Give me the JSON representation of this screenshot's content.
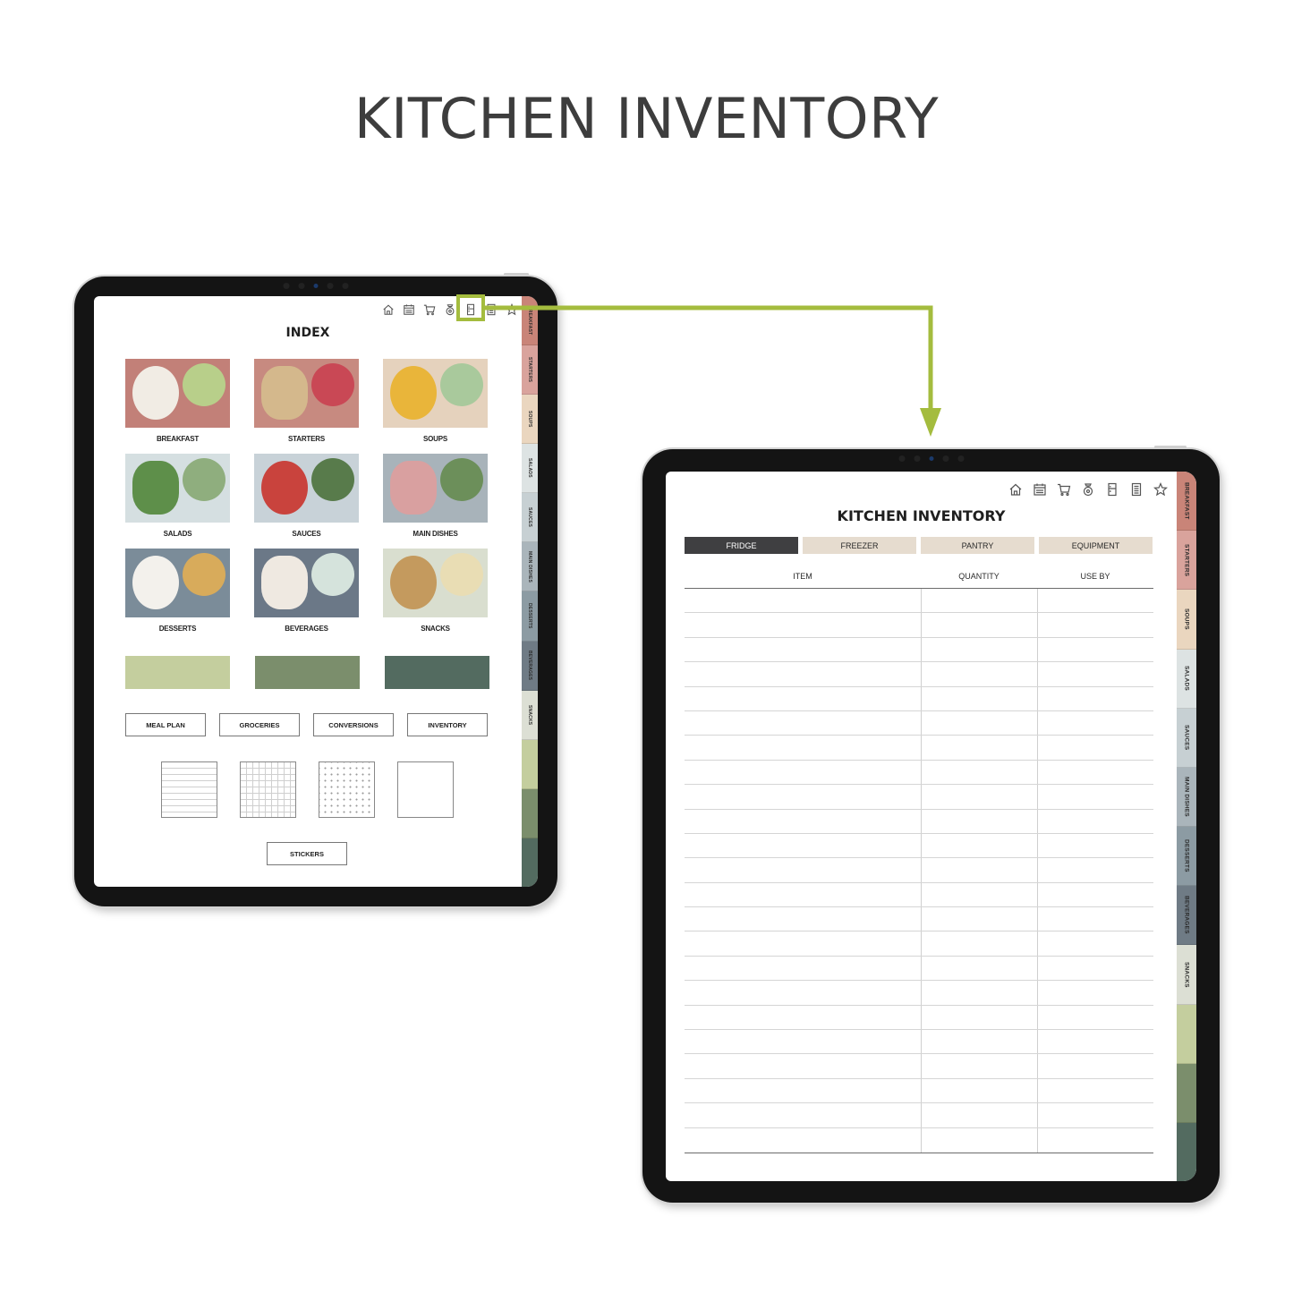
{
  "page": {
    "title": "KITCHEN INVENTORY",
    "accent_color": "#a4bc3e"
  },
  "nav_icons": [
    "home-icon",
    "calendar-icon",
    "cart-icon",
    "scale-icon",
    "fridge-icon",
    "notes-icon",
    "star-icon"
  ],
  "highlighted_nav_icon": "fridge-icon",
  "side_tabs": [
    {
      "label": "BREAKFAST",
      "color": "#c98478"
    },
    {
      "label": "STARTERS",
      "color": "#d9a39c"
    },
    {
      "label": "SOUPS",
      "color": "#ead6bf"
    },
    {
      "label": "SALADS",
      "color": "#dde3e3"
    },
    {
      "label": "SAUCES",
      "color": "#c7d0d3"
    },
    {
      "label": "MAIN DISHES",
      "color": "#aab5bb"
    },
    {
      "label": "DESSERTS",
      "color": "#8c9ba3"
    },
    {
      "label": "BEVERAGES",
      "color": "#6f7b85"
    },
    {
      "label": "SNACKS",
      "color": "#dcdfd4"
    },
    {
      "label": "",
      "color": "#c4ce9e"
    },
    {
      "label": "",
      "color": "#7b8e6c"
    },
    {
      "label": "",
      "color": "#536b60"
    }
  ],
  "index_page": {
    "title": "INDEX",
    "categories": [
      {
        "label": "BREAKFAST",
        "bg": "#c28078",
        "a": "#f1ece4",
        "b": "#b8cf8a"
      },
      {
        "label": "STARTERS",
        "bg": "#c78a80",
        "a": "#d4b88c",
        "b": "#c94855"
      },
      {
        "label": "SOUPS",
        "bg": "#e5d2bd",
        "a": "#e9b53a",
        "b": "#a9c99c"
      },
      {
        "label": "SALADS",
        "bg": "#d5dfe1",
        "a": "#5e8f4a",
        "b": "#8fae7e"
      },
      {
        "label": "SAUCES",
        "bg": "#c8d2d8",
        "a": "#c9433d",
        "b": "#587b4b"
      },
      {
        "label": "MAIN DISHES",
        "bg": "#a8b3ba",
        "a": "#d9a0a0",
        "b": "#6c8f5a"
      },
      {
        "label": "DESSERTS",
        "bg": "#7b8c99",
        "a": "#f3f1ec",
        "b": "#d8ab5b"
      },
      {
        "label": "BEVERAGES",
        "bg": "#6b7887",
        "a": "#efe9e1",
        "b": "#d5e3dc"
      },
      {
        "label": "SNACKS",
        "bg": "#d9decf",
        "a": "#c49a5e",
        "b": "#e9ddb4"
      }
    ],
    "swatches": [
      "#c4ce9e",
      "#7b8e6c",
      "#536b60"
    ],
    "links": [
      "MEAL PLAN",
      "GROCERIES",
      "CONVERSIONS",
      "INVENTORY"
    ],
    "paper_templates": [
      "lined",
      "grid",
      "dot",
      "blank"
    ],
    "stickers_label": "STICKERS"
  },
  "inventory_page": {
    "title": "KITCHEN INVENTORY",
    "tabs": [
      {
        "label": "FRIDGE",
        "active": true
      },
      {
        "label": "FREEZER",
        "active": false
      },
      {
        "label": "PANTRY",
        "active": false
      },
      {
        "label": "EQUIPMENT",
        "active": false
      }
    ],
    "columns": [
      "ITEM",
      "QUANTITY",
      "USE BY"
    ],
    "row_count": 23
  }
}
